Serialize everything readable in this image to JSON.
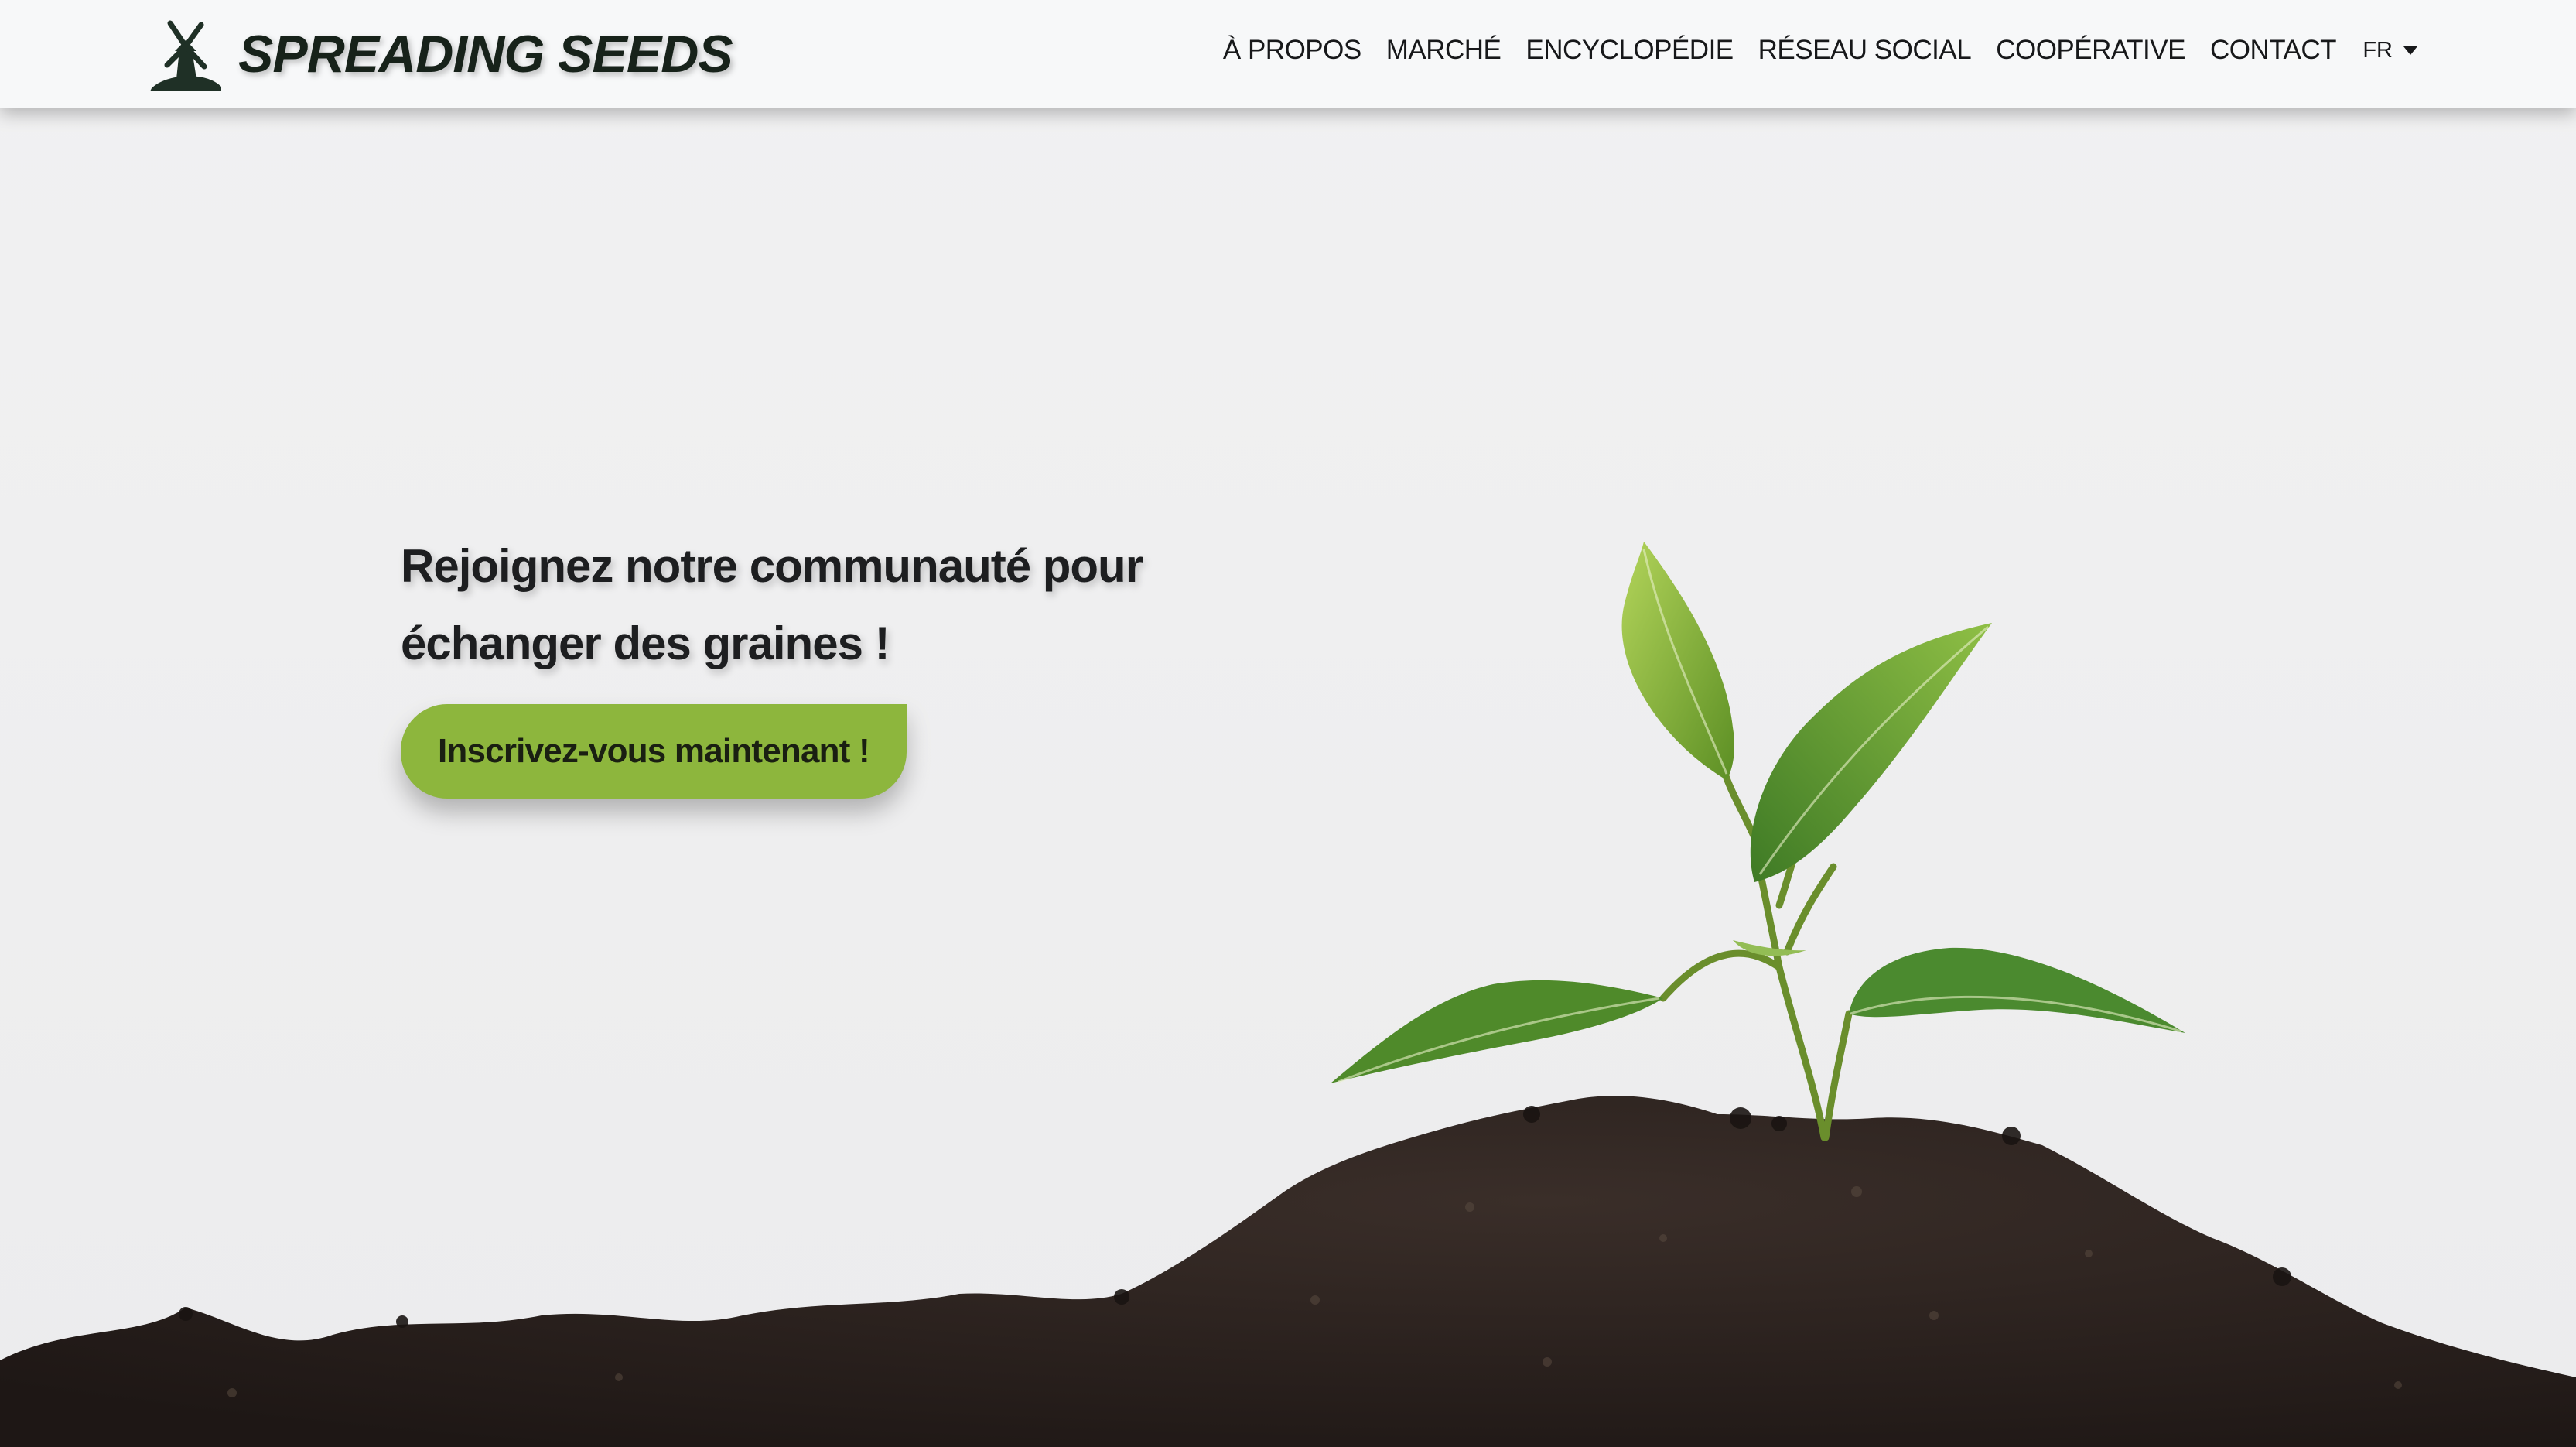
{
  "brand": {
    "name": "SPREADING SEEDS",
    "logo_icon": "windmill-icon"
  },
  "nav": {
    "items": [
      {
        "label": "À PROPOS"
      },
      {
        "label": "MARCHÉ"
      },
      {
        "label": "ENCYCLOPÉDIE"
      },
      {
        "label": "RÉSEAU SOCIAL"
      },
      {
        "label": "COOPÉRATIVE"
      },
      {
        "label": "CONTACT"
      }
    ],
    "language": {
      "selected": "FR",
      "icon": "caret-down-icon"
    }
  },
  "hero": {
    "headline_line1": "Rejoignez notre communauté pour",
    "headline_line2": "échanger des graines !",
    "cta_label": "Inscrivez-vous maintenant !",
    "image_icon": "seedling-in-soil-image"
  },
  "colors": {
    "navbar_bg": "#f7f8f9",
    "hero_bg": "#eeeeef",
    "accent": "#8db63d",
    "text": "#17181a",
    "soil": "#2a211d",
    "leaf": "#6a9a2a"
  }
}
